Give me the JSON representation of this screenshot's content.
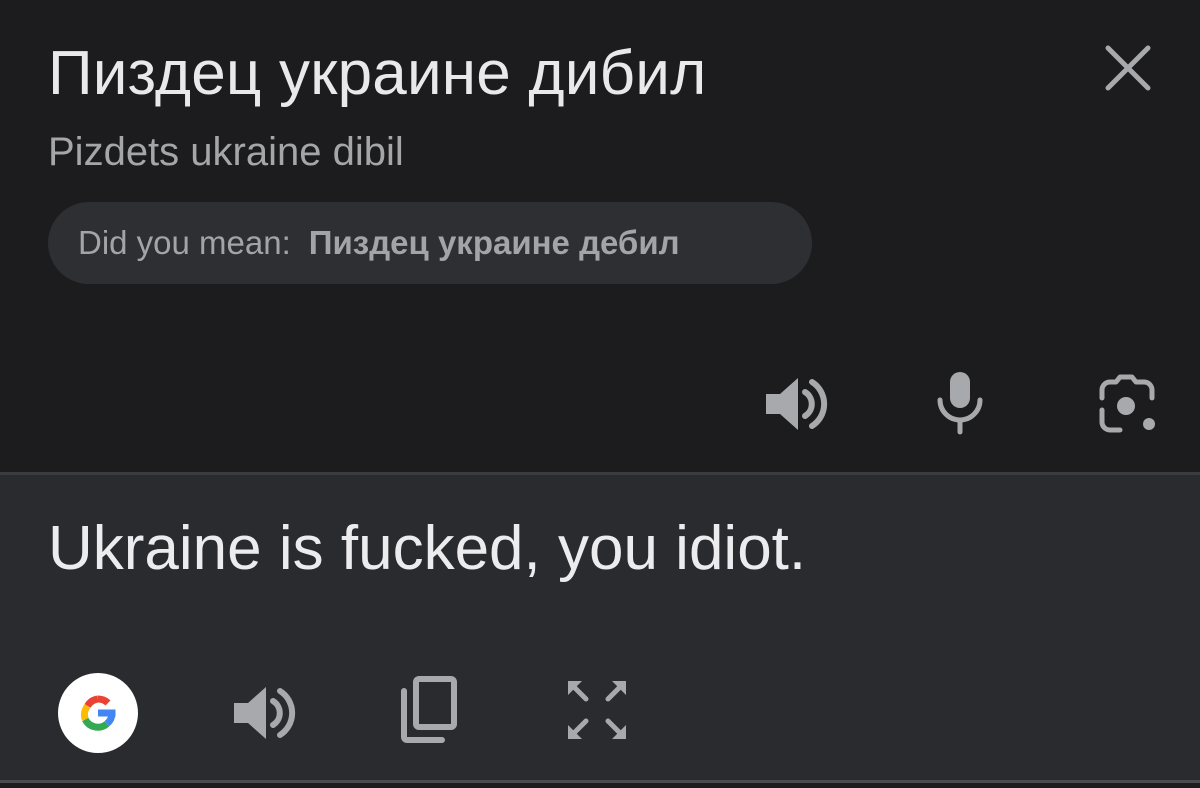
{
  "source": {
    "text": "Пиздец украине дибил",
    "transliteration": "Pizdets ukraine dibil",
    "did_you_mean": {
      "label": "Did you mean:",
      "suggestion": "Пиздец украине дебил"
    },
    "icons": {
      "close": "close-icon",
      "speaker": "speaker-icon",
      "microphone": "microphone-icon",
      "camera": "camera-icon"
    }
  },
  "translation": {
    "text": "Ukraine is fucked, you idiot.",
    "icons": {
      "google": "google-logo-icon",
      "speaker": "speaker-icon",
      "copy": "copy-icon",
      "fullscreen": "fullscreen-icon"
    }
  },
  "colors": {
    "source_background": "#1c1c1e",
    "translation_background": "#2a2b2f",
    "chip_background": "#2e2f33",
    "primary_text": "#e9e9eb",
    "secondary_text": "#a5a6aa",
    "icon": "#a8a9ad"
  }
}
